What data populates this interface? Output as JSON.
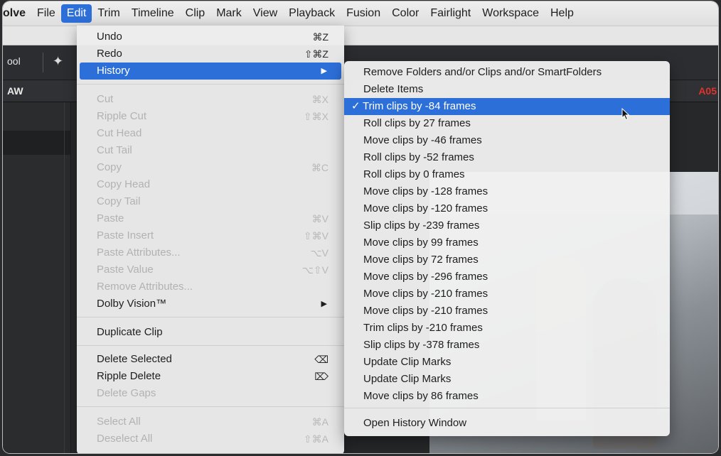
{
  "menubar": {
    "app": "olve",
    "items": [
      "File",
      "Edit",
      "Trim",
      "Timeline",
      "Clip",
      "Mark",
      "View",
      "Playback",
      "Fusion",
      "Color",
      "Fairlight",
      "Workspace",
      "Help"
    ],
    "active": "Edit"
  },
  "toolbar": {
    "pool_label": "ool"
  },
  "subbar": {
    "left_label": "AW",
    "timecode": "A05"
  },
  "edit_menu": {
    "undo": {
      "label": "Undo",
      "shortcut": "⌘Z"
    },
    "redo": {
      "label": "Redo",
      "shortcut": "⇧⌘Z"
    },
    "history": {
      "label": "History",
      "arrow": "▶"
    },
    "cut": {
      "label": "Cut",
      "shortcut": "⌘X"
    },
    "ripple_cut": {
      "label": "Ripple Cut",
      "shortcut": "⇧⌘X"
    },
    "cut_head": {
      "label": "Cut Head"
    },
    "cut_tail": {
      "label": "Cut Tail"
    },
    "copy": {
      "label": "Copy",
      "shortcut": "⌘C"
    },
    "copy_head": {
      "label": "Copy Head"
    },
    "copy_tail": {
      "label": "Copy Tail"
    },
    "paste": {
      "label": "Paste",
      "shortcut": "⌘V"
    },
    "paste_insert": {
      "label": "Paste Insert",
      "shortcut": "⇧⌘V"
    },
    "paste_attributes": {
      "label": "Paste Attributes...",
      "shortcut": "⌥V"
    },
    "paste_value": {
      "label": "Paste Value",
      "shortcut": "⌥⇧V"
    },
    "remove_attributes": {
      "label": "Remove Attributes..."
    },
    "dolby_vision": {
      "label": "Dolby Vision™",
      "arrow": "▶"
    },
    "duplicate_clip": {
      "label": "Duplicate Clip"
    },
    "delete_selected": {
      "label": "Delete Selected",
      "shortcut": "⌫"
    },
    "ripple_delete": {
      "label": "Ripple Delete",
      "shortcut": "⌦"
    },
    "delete_gaps": {
      "label": "Delete Gaps"
    },
    "select_all": {
      "label": "Select All",
      "shortcut": "⌘A"
    },
    "deselect_all": {
      "label": "Deselect All",
      "shortcut": "⇧⌘A"
    }
  },
  "history_menu": {
    "check": "✓",
    "items": [
      "Remove Folders and/or Clips and/or SmartFolders",
      "Delete Items",
      "Trim clips by -84 frames",
      "Roll clips by 27 frames",
      "Move clips by -46 frames",
      "Roll clips by -52 frames",
      "Roll clips by 0 frames",
      "Move clips by -128 frames",
      "Move clips by -120 frames",
      "Slip clips by -239 frames",
      "Move clips by 99 frames",
      "Move clips by 72 frames",
      "Move clips by -296 frames",
      "Move clips by -210 frames",
      "Move clips by -210 frames",
      "Trim clips by -210 frames",
      "Slip clips by -378 frames",
      "Update Clip Marks",
      "Update Clip Marks",
      "Move clips by 86 frames"
    ],
    "open_window": "Open History Window"
  }
}
